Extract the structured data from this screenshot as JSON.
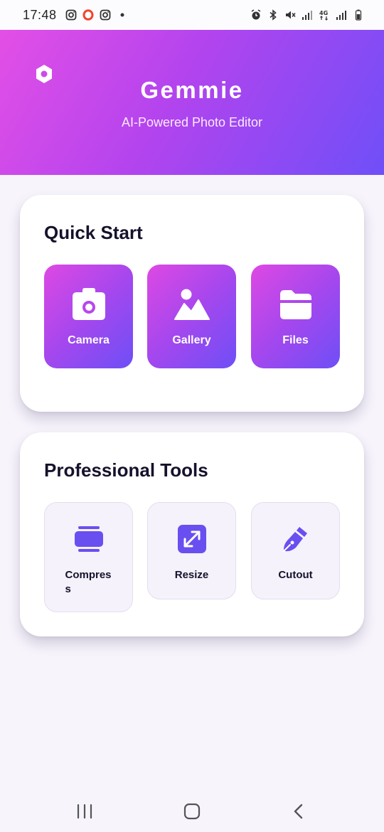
{
  "status_bar": {
    "time": "17:48",
    "left_icons": [
      "instagram-icon",
      "opera-icon",
      "instagram-icon",
      "notification-dot-icon"
    ],
    "right_icons": [
      "alarm-icon",
      "bluetooth-icon",
      "mute-icon",
      "wifi-signal-icon",
      "network-4g-icon",
      "cell-signal-icon",
      "battery-icon"
    ]
  },
  "header": {
    "logo_icon": "hexagon-logo-icon",
    "title": "Gemmie",
    "subtitle": "AI-Powered Photo Editor",
    "gradient": [
      "#e34fe6",
      "#6f4ff8"
    ]
  },
  "quick_start": {
    "title": "Quick Start",
    "items": [
      {
        "label": "Camera",
        "icon": "camera-icon"
      },
      {
        "label": "Gallery",
        "icon": "image-icon"
      },
      {
        "label": "Files",
        "icon": "folder-icon"
      }
    ]
  },
  "professional_tools": {
    "title": "Professional Tools",
    "items": [
      {
        "label": "Compress",
        "icon": "compress-icon"
      },
      {
        "label": "Resize",
        "icon": "resize-icon"
      },
      {
        "label": "Cutout",
        "icon": "cutout-icon"
      }
    ]
  },
  "colors": {
    "accent": "#6e4ff6",
    "brand_pink": "#de49e3",
    "background": "#f7f4fc"
  },
  "nav_bar": {
    "items": [
      "recent-apps-icon",
      "home-icon",
      "back-icon"
    ]
  }
}
